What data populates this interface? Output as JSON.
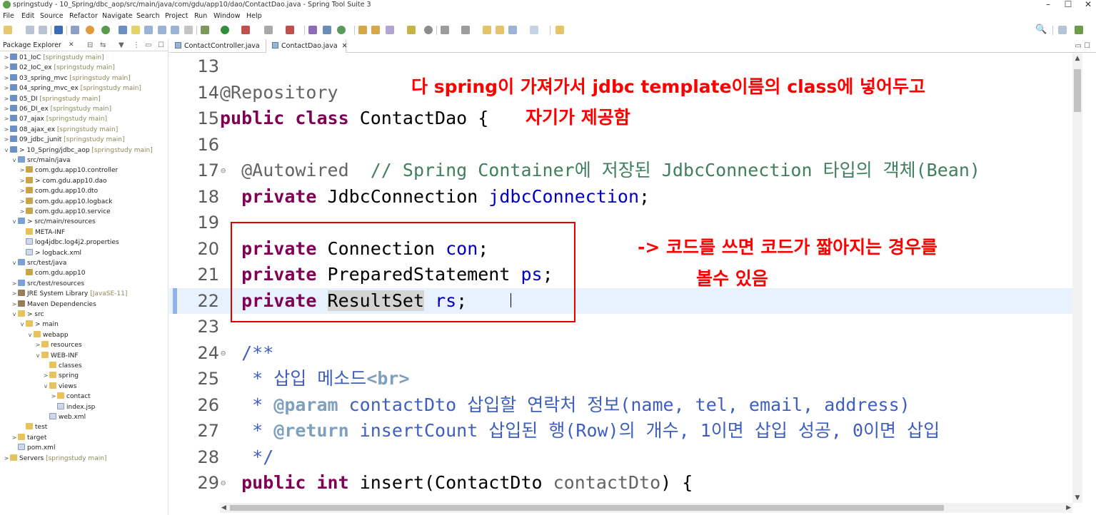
{
  "window": {
    "title": "springstudy - 10_Spring/dbc_aop/src/main/java/com/gdu/app10/dao/ContactDao.java - Spring Tool Suite 3",
    "controls": [
      "–",
      "☐",
      "✕"
    ]
  },
  "menu": [
    "File",
    "Edit",
    "Source",
    "Refactor",
    "Navigate",
    "Search",
    "Project",
    "Run",
    "Window",
    "Help"
  ],
  "explorer": {
    "title": "Package Explorer",
    "tree": [
      {
        "indent": 0,
        "tw": ">",
        "icon": "proj",
        "label": "01_IoC",
        "dim": "[springstudy main]"
      },
      {
        "indent": 0,
        "tw": ">",
        "icon": "proj",
        "label": "02_IoC_ex",
        "dim": "[springstudy main]"
      },
      {
        "indent": 0,
        "tw": ">",
        "icon": "proj",
        "label": "03_spring_mvc",
        "dim": "[springstudy main]"
      },
      {
        "indent": 0,
        "tw": ">",
        "icon": "proj",
        "label": "04_spring_mvc_ex",
        "dim": "[springstudy main]"
      },
      {
        "indent": 0,
        "tw": ">",
        "icon": "proj",
        "label": "05_DI",
        "dim": "[springstudy main]"
      },
      {
        "indent": 0,
        "tw": ">",
        "icon": "proj",
        "label": "06_DI_ex",
        "dim": "[springstudy main]"
      },
      {
        "indent": 0,
        "tw": ">",
        "icon": "proj",
        "label": "07_ajax",
        "dim": "[springstudy main]"
      },
      {
        "indent": 0,
        "tw": ">",
        "icon": "proj",
        "label": "08_ajax_ex",
        "dim": "[springstudy main]"
      },
      {
        "indent": 0,
        "tw": ">",
        "icon": "proj",
        "label": "09_jdbc_junit",
        "dim": "[springstudy main]"
      },
      {
        "indent": 0,
        "tw": "v",
        "icon": "proj",
        "label": "> 10_Spring/jdbc_aop",
        "dim": "[springstudy main]"
      },
      {
        "indent": 1,
        "tw": "v",
        "icon": "src",
        "label": "src/main/java",
        "dim": ""
      },
      {
        "indent": 2,
        "tw": ">",
        "icon": "pkg",
        "label": "com.gdu.app10.controller",
        "dim": ""
      },
      {
        "indent": 2,
        "tw": ">",
        "icon": "pkg",
        "label": "> com.gdu.app10.dao",
        "dim": ""
      },
      {
        "indent": 2,
        "tw": ">",
        "icon": "pkg",
        "label": "com.gdu.app10.dto",
        "dim": ""
      },
      {
        "indent": 2,
        "tw": ">",
        "icon": "pkg",
        "label": "com.gdu.app10.logback",
        "dim": ""
      },
      {
        "indent": 2,
        "tw": ">",
        "icon": "pkg",
        "label": "com.gdu.app10.service",
        "dim": ""
      },
      {
        "indent": 1,
        "tw": "v",
        "icon": "src",
        "label": "> src/main/resources",
        "dim": ""
      },
      {
        "indent": 2,
        "tw": "",
        "icon": "fold",
        "label": "META-INF",
        "dim": ""
      },
      {
        "indent": 2,
        "tw": "",
        "icon": "file",
        "label": "log4jdbc.log4j2.properties",
        "dim": ""
      },
      {
        "indent": 2,
        "tw": "",
        "icon": "file",
        "label": "> logback.xml",
        "dim": ""
      },
      {
        "indent": 1,
        "tw": "v",
        "icon": "src",
        "label": "src/test/java",
        "dim": ""
      },
      {
        "indent": 2,
        "tw": "",
        "icon": "pkg",
        "label": "com.gdu.app10",
        "dim": ""
      },
      {
        "indent": 1,
        "tw": ">",
        "icon": "src",
        "label": "src/test/resources",
        "dim": ""
      },
      {
        "indent": 1,
        "tw": ">",
        "icon": "lib",
        "label": "JRE System Library",
        "dim": "[JavaSE-11]"
      },
      {
        "indent": 1,
        "tw": ">",
        "icon": "lib",
        "label": "Maven Dependencies",
        "dim": ""
      },
      {
        "indent": 1,
        "tw": "v",
        "icon": "fold",
        "label": "> src",
        "dim": ""
      },
      {
        "indent": 2,
        "tw": "v",
        "icon": "fold",
        "label": "> main",
        "dim": ""
      },
      {
        "indent": 3,
        "tw": "v",
        "icon": "fold",
        "label": "webapp",
        "dim": ""
      },
      {
        "indent": 4,
        "tw": ">",
        "icon": "fold",
        "label": "resources",
        "dim": ""
      },
      {
        "indent": 4,
        "tw": "v",
        "icon": "fold",
        "label": "WEB-INF",
        "dim": ""
      },
      {
        "indent": 5,
        "tw": "",
        "icon": "fold",
        "label": "classes",
        "dim": ""
      },
      {
        "indent": 5,
        "tw": ">",
        "icon": "fold",
        "label": "spring",
        "dim": ""
      },
      {
        "indent": 5,
        "tw": "v",
        "icon": "fold",
        "label": "views",
        "dim": ""
      },
      {
        "indent": 6,
        "tw": ">",
        "icon": "fold",
        "label": "contact",
        "dim": ""
      },
      {
        "indent": 6,
        "tw": "",
        "icon": "file",
        "label": "index.jsp",
        "dim": ""
      },
      {
        "indent": 5,
        "tw": "",
        "icon": "file",
        "label": "web.xml",
        "dim": ""
      },
      {
        "indent": 2,
        "tw": "",
        "icon": "fold",
        "label": "test",
        "dim": ""
      },
      {
        "indent": 1,
        "tw": ">",
        "icon": "fold",
        "label": "target",
        "dim": ""
      },
      {
        "indent": 1,
        "tw": "",
        "icon": "file",
        "label": "pom.xml",
        "dim": ""
      },
      {
        "indent": 0,
        "tw": ">",
        "icon": "fold",
        "label": "Servers",
        "dim": "[springstudy main]"
      }
    ]
  },
  "editor": {
    "tabs": [
      {
        "label": "ContactController.java",
        "active": false
      },
      {
        "label": "ContactDao.java",
        "active": true
      }
    ],
    "line_numbers": [
      "13",
      "14",
      "15",
      "16",
      "17",
      "18",
      "19",
      "20",
      "21",
      "22",
      "23",
      "24",
      "25",
      "26",
      "27",
      "28",
      "29"
    ],
    "fold_markers": [
      "",
      "",
      "",
      "",
      "⊖",
      "",
      "",
      "",
      "",
      "",
      "",
      "⊖",
      "",
      "",
      "",
      "",
      "⊖"
    ],
    "lines": [
      [],
      [
        {
          "c": "an",
          "t": "@Repository"
        }
      ],
      [
        {
          "c": "kw",
          "t": "public"
        },
        {
          "c": "",
          "t": " "
        },
        {
          "c": "kw",
          "t": "class"
        },
        {
          "c": "",
          "t": " ContactDao {"
        }
      ],
      [],
      [
        {
          "c": "",
          "t": "  "
        },
        {
          "c": "an",
          "t": "@Autowired"
        },
        {
          "c": "",
          "t": "  "
        },
        {
          "c": "cm",
          "t": "// Spring Container에 저장된 JdbcConnection 타입의 객체(Bean)"
        }
      ],
      [
        {
          "c": "",
          "t": "  "
        },
        {
          "c": "kw",
          "t": "private"
        },
        {
          "c": "",
          "t": " JdbcConnection "
        },
        {
          "c": "fld",
          "t": "jdbcConnection"
        },
        {
          "c": "",
          "t": ";"
        }
      ],
      [],
      [
        {
          "c": "",
          "t": "  "
        },
        {
          "c": "kw",
          "t": "private"
        },
        {
          "c": "",
          "t": " Connection "
        },
        {
          "c": "fld",
          "t": "con"
        },
        {
          "c": "",
          "t": ";"
        }
      ],
      [
        {
          "c": "",
          "t": "  "
        },
        {
          "c": "kw",
          "t": "private"
        },
        {
          "c": "",
          "t": " PreparedStatement "
        },
        {
          "c": "fld",
          "t": "ps"
        },
        {
          "c": "",
          "t": ";"
        }
      ],
      [
        {
          "c": "",
          "t": "  "
        },
        {
          "c": "kw",
          "t": "private"
        },
        {
          "c": "",
          "t": " "
        },
        {
          "c": "occ",
          "t": "ResultSet"
        },
        {
          "c": "",
          "t": " "
        },
        {
          "c": "fld",
          "t": "rs"
        },
        {
          "c": "",
          "t": ";"
        }
      ],
      [],
      [
        {
          "c": "",
          "t": "  "
        },
        {
          "c": "jd",
          "t": "/**"
        }
      ],
      [
        {
          "c": "jd",
          "t": "   * 삽입 메소드"
        },
        {
          "c": "jt",
          "t": "<br>"
        }
      ],
      [
        {
          "c": "jd",
          "t": "   * "
        },
        {
          "c": "jt",
          "t": "@param"
        },
        {
          "c": "jd",
          "t": " contactDto 삽입할 연락처 정보(name, tel, email, address)"
        }
      ],
      [
        {
          "c": "jd",
          "t": "   * "
        },
        {
          "c": "jt",
          "t": "@return"
        },
        {
          "c": "jd",
          "t": " insertCount 삽입된 행(Row)의 개수, 1이면 삽입 성공, 0이면 삽입"
        }
      ],
      [
        {
          "c": "jd",
          "t": "   */"
        }
      ],
      [
        {
          "c": "",
          "t": "  "
        },
        {
          "c": "kw",
          "t": "public"
        },
        {
          "c": "",
          "t": " "
        },
        {
          "c": "kw",
          "t": "int"
        },
        {
          "c": "",
          "t": " insert(ContactDto "
        },
        {
          "c": "an",
          "t": "contactDto"
        },
        {
          "c": "",
          "t": ") {"
        }
      ]
    ]
  },
  "annotations": {
    "line1": "다 spring이 가져가서 jdbc template이름의 class에 넣어두고",
    "line2": "자기가 제공함",
    "line3": "-> 코드를 쓰면 코드가 짧아지는 경우를",
    "line4": "볼수 있음"
  },
  "colors": {
    "annotation": "#ff0000",
    "keyword": "#7f0055",
    "comment": "#3f7f5f",
    "javadoc": "#3f5fbf",
    "field": "#0000c0",
    "current_line": "#e8f2fe"
  }
}
